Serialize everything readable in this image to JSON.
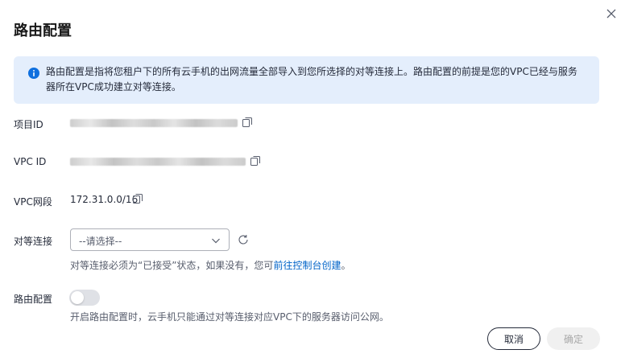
{
  "dialog": {
    "title": "路由配置"
  },
  "info": {
    "text": "路由配置是指将您租户下的所有云手机的出网流量全部导入到您所选择的对等连接上。路由配置的前提是您的VPC已经与服务器所在VPC成功建立对等连接。"
  },
  "fields": {
    "project_id_label": "项目ID",
    "vpc_id_label": "VPC ID",
    "vpc_cidr_label": "VPC网段",
    "vpc_cidr_value": "172.31.0.0/16",
    "peering_label": "对等连接",
    "peering_placeholder": "--请选择--",
    "peering_hint_prefix": "对等连接必须为“已接受”状态，如果没有，您可",
    "peering_hint_link": "前往控制台创建",
    "peering_hint_suffix": "。",
    "route_label": "路由配置",
    "route_hint": "开启路由配置时，云手机只能通过对等连接对应VPC下的服务器访问公网。"
  },
  "footer": {
    "cancel_label": "取消",
    "ok_label": "确定"
  },
  "toggle": {
    "route_enabled": false
  },
  "colors": {
    "info_bg": "#e4eefc",
    "info_icon": "#0f6fde",
    "link": "#0063c8",
    "toggle_off": "#dfe1e6",
    "disabled_btn_bg": "#f0f0f0"
  }
}
